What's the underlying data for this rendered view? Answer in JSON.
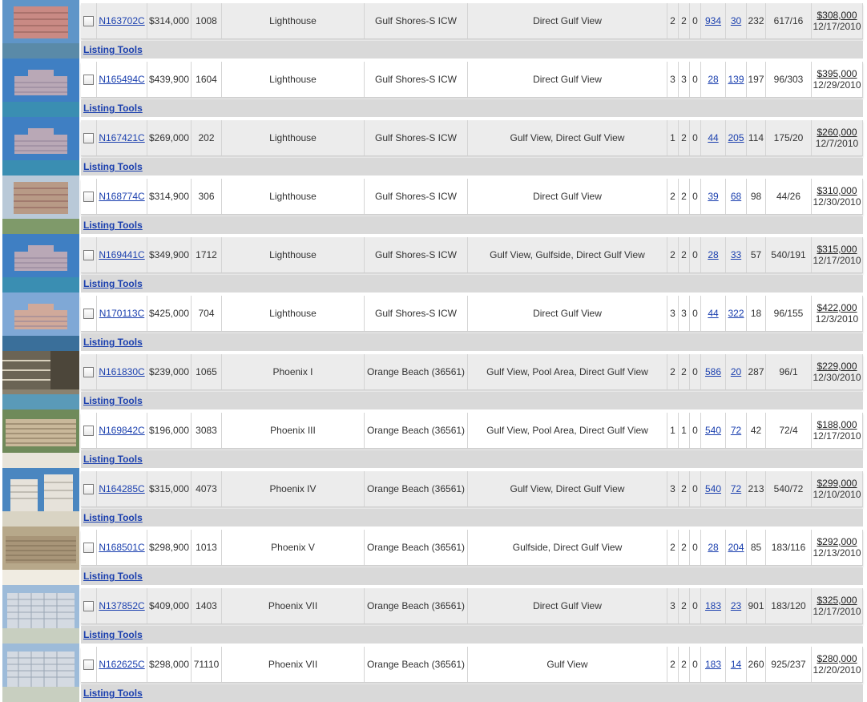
{
  "tools_label": "Listing Tools",
  "listings": [
    {
      "mls": "N163702C",
      "price": "$314,000",
      "dom": "1008",
      "complex": "Lighthouse",
      "area": "Gulf Shores-S ICW",
      "view": "Direct Gulf View",
      "beds": "2",
      "baths": "2",
      "half": "0",
      "link1": "934",
      "link2": "30",
      "num3": "232",
      "ratio": "617/16",
      "sold_price": "$308,000",
      "sold_date": "12/17/2010",
      "photo": {
        "sky": "#5f95c8",
        "bldg": "#c98a84",
        "ground": "#5a8aa8",
        "style": "tall"
      }
    },
    {
      "mls": "N165494C",
      "price": "$439,900",
      "dom": "1604",
      "complex": "Lighthouse",
      "area": "Gulf Shores-S ICW",
      "view": "Direct Gulf View",
      "beds": "3",
      "baths": "3",
      "half": "0",
      "link1": "28",
      "link2": "139",
      "num3": "197",
      "ratio": "96/303",
      "sold_price": "$395,000",
      "sold_date": "12/29/2010",
      "photo": {
        "sky": "#3f7fc3",
        "bldg": "#b9a8b6",
        "ground": "#3a8eb2",
        "style": "wide"
      }
    },
    {
      "mls": "N167421C",
      "price": "$269,000",
      "dom": "202",
      "complex": "Lighthouse",
      "area": "Gulf Shores-S ICW",
      "view": "Gulf View, Direct Gulf View",
      "beds": "1",
      "baths": "2",
      "half": "0",
      "link1": "44",
      "link2": "205",
      "num3": "114",
      "ratio": "175/20",
      "sold_price": "$260,000",
      "sold_date": "12/7/2010",
      "photo": {
        "sky": "#3f7fc3",
        "bldg": "#b9a8b6",
        "ground": "#3a8eb2",
        "style": "wide"
      }
    },
    {
      "mls": "N168774C",
      "price": "$314,900",
      "dom": "306",
      "complex": "Lighthouse",
      "area": "Gulf Shores-S ICW",
      "view": "Direct Gulf View",
      "beds": "2",
      "baths": "2",
      "half": "0",
      "link1": "39",
      "link2": "68",
      "num3": "98",
      "ratio": "44/26",
      "sold_price": "$310,000",
      "sold_date": "12/30/2010",
      "photo": {
        "sky": "#b9c9d8",
        "bldg": "#b89a86",
        "ground": "#7f9a6a",
        "style": "tall"
      }
    },
    {
      "mls": "N169441C",
      "price": "$349,900",
      "dom": "1712",
      "complex": "Lighthouse",
      "area": "Gulf Shores-S ICW",
      "view": "Gulf View, Gulfside, Direct Gulf View",
      "beds": "2",
      "baths": "2",
      "half": "0",
      "link1": "28",
      "link2": "33",
      "num3": "57",
      "ratio": "540/191",
      "sold_price": "$315,000",
      "sold_date": "12/17/2010",
      "photo": {
        "sky": "#3f7fc3",
        "bldg": "#b9a8b6",
        "ground": "#3a8eb2",
        "style": "wide"
      }
    },
    {
      "mls": "N170113C",
      "price": "$425,000",
      "dom": "704",
      "complex": "Lighthouse",
      "area": "Gulf Shores-S ICW",
      "view": "Direct Gulf View",
      "beds": "3",
      "baths": "3",
      "half": "0",
      "link1": "44",
      "link2": "322",
      "num3": "18",
      "ratio": "96/155",
      "sold_price": "$422,000",
      "sold_date": "12/3/2010",
      "photo": {
        "sky": "#7fa8d6",
        "bldg": "#d0a99a",
        "ground": "#3a6f9a",
        "style": "wide"
      }
    },
    {
      "mls": "N161830C",
      "price": "$239,000",
      "dom": "1065",
      "complex": "Phoenix I",
      "area": "Orange Beach (36561)",
      "view": "Gulf View, Pool Area, Direct Gulf View",
      "beds": "2",
      "baths": "2",
      "half": "0",
      "link1": "586",
      "link2": "20",
      "num3": "287",
      "ratio": "96/1",
      "sold_price": "$229,000",
      "sold_date": "12/30/2010",
      "photo": {
        "sky": "#8a8270",
        "bldg": "#6b6455",
        "ground": "#5a9ab8",
        "style": "balcony"
      }
    },
    {
      "mls": "N169842C",
      "price": "$196,000",
      "dom": "3083",
      "complex": "Phoenix III",
      "area": "Orange Beach (36561)",
      "view": "Gulf View, Pool Area, Direct Gulf View",
      "beds": "1",
      "baths": "1",
      "half": "0",
      "link1": "540",
      "link2": "72",
      "num3": "42",
      "ratio": "72/4",
      "sold_price": "$188,000",
      "sold_date": "12/17/2010",
      "photo": {
        "sky": "#6f8a5a",
        "bldg": "#c9b89a",
        "ground": "#e8e4da",
        "style": "long"
      }
    },
    {
      "mls": "N164285C",
      "price": "$315,000",
      "dom": "4073",
      "complex": "Phoenix IV",
      "area": "Orange Beach (36561)",
      "view": "Gulf View, Direct Gulf View",
      "beds": "3",
      "baths": "2",
      "half": "0",
      "link1": "540",
      "link2": "72",
      "num3": "213",
      "ratio": "540/72",
      "sold_price": "$299,000",
      "sold_date": "12/10/2010",
      "photo": {
        "sky": "#4a86c0",
        "bldg": "#e6e2da",
        "ground": "#d9d4c4",
        "style": "tower"
      }
    },
    {
      "mls": "N168501C",
      "price": "$298,900",
      "dom": "1013",
      "complex": "Phoenix V",
      "area": "Orange Beach (36561)",
      "view": "Gulfside, Direct Gulf View",
      "beds": "2",
      "baths": "2",
      "half": "0",
      "link1": "28",
      "link2": "204",
      "num3": "85",
      "ratio": "183/116",
      "sold_price": "$292,000",
      "sold_date": "12/13/2010",
      "photo": {
        "sky": "#b7a88a",
        "bldg": "#a89578",
        "ground": "#f0ece2",
        "style": "long"
      }
    },
    {
      "mls": "N137852C",
      "price": "$409,000",
      "dom": "1403",
      "complex": "Phoenix VII",
      "area": "Orange Beach (36561)",
      "view": "Direct Gulf View",
      "beds": "3",
      "baths": "2",
      "half": "0",
      "link1": "183",
      "link2": "23",
      "num3": "901",
      "ratio": "183/120",
      "sold_price": "$325,000",
      "sold_date": "12/17/2010",
      "photo": {
        "sky": "#9dbbd9",
        "bldg": "#d4dae2",
        "ground": "#c8cfc0",
        "style": "grid"
      }
    },
    {
      "mls": "N162625C",
      "price": "$298,000",
      "dom": "71110",
      "complex": "Phoenix VII",
      "area": "Orange Beach (36561)",
      "view": "Gulf View",
      "beds": "2",
      "baths": "2",
      "half": "0",
      "link1": "183",
      "link2": "14",
      "num3": "260",
      "ratio": "925/237",
      "sold_price": "$280,000",
      "sold_date": "12/20/2010",
      "photo": {
        "sky": "#9dbbd9",
        "bldg": "#d4dae2",
        "ground": "#c8cfc0",
        "style": "grid"
      }
    }
  ]
}
